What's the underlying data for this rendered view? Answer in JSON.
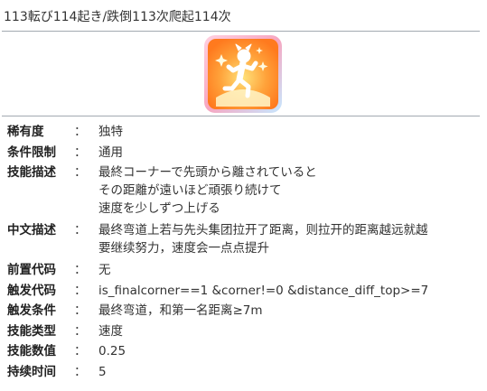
{
  "header": {
    "title": "113転び114起き/跌倒113次爬起114次"
  },
  "icon": {
    "name": "running-figure-skill-icon",
    "colors": {
      "frame": "#f7a6c0",
      "inner": "#ff8c2a",
      "glow": "#fff3a0"
    }
  },
  "details": {
    "colon": "：",
    "rarity": {
      "label": "稀有度",
      "value": "独特"
    },
    "condition_limit": {
      "label": "条件限制",
      "value": "通用"
    },
    "skill_desc": {
      "label": "技能描述",
      "lines": [
        "最終コーナーで先頭から離されていると",
        "その距離が遠いほど頑張り続けて",
        "速度を少しずつ上げる"
      ]
    },
    "cn_desc": {
      "label": "中文描述",
      "lines": [
        "最终弯道上若与先头集团拉开了距离，则拉开的距离越远就越",
        "要继续努力，速度会一点点提升"
      ]
    },
    "prereq_code": {
      "label": "前置代码",
      "value": "无"
    },
    "trigger_code": {
      "label": "触发代码",
      "value": "is_finalcorner==1 &corner!=0 &distance_diff_top>=7"
    },
    "trigger_cond": {
      "label": "触发条件",
      "value": "最终弯道，和第一名距离≥7m"
    },
    "skill_type": {
      "label": "技能类型",
      "value": "速度"
    },
    "skill_value": {
      "label": "技能数值",
      "value": "0.25"
    },
    "duration": {
      "label": "持续时间",
      "value": "5"
    }
  }
}
